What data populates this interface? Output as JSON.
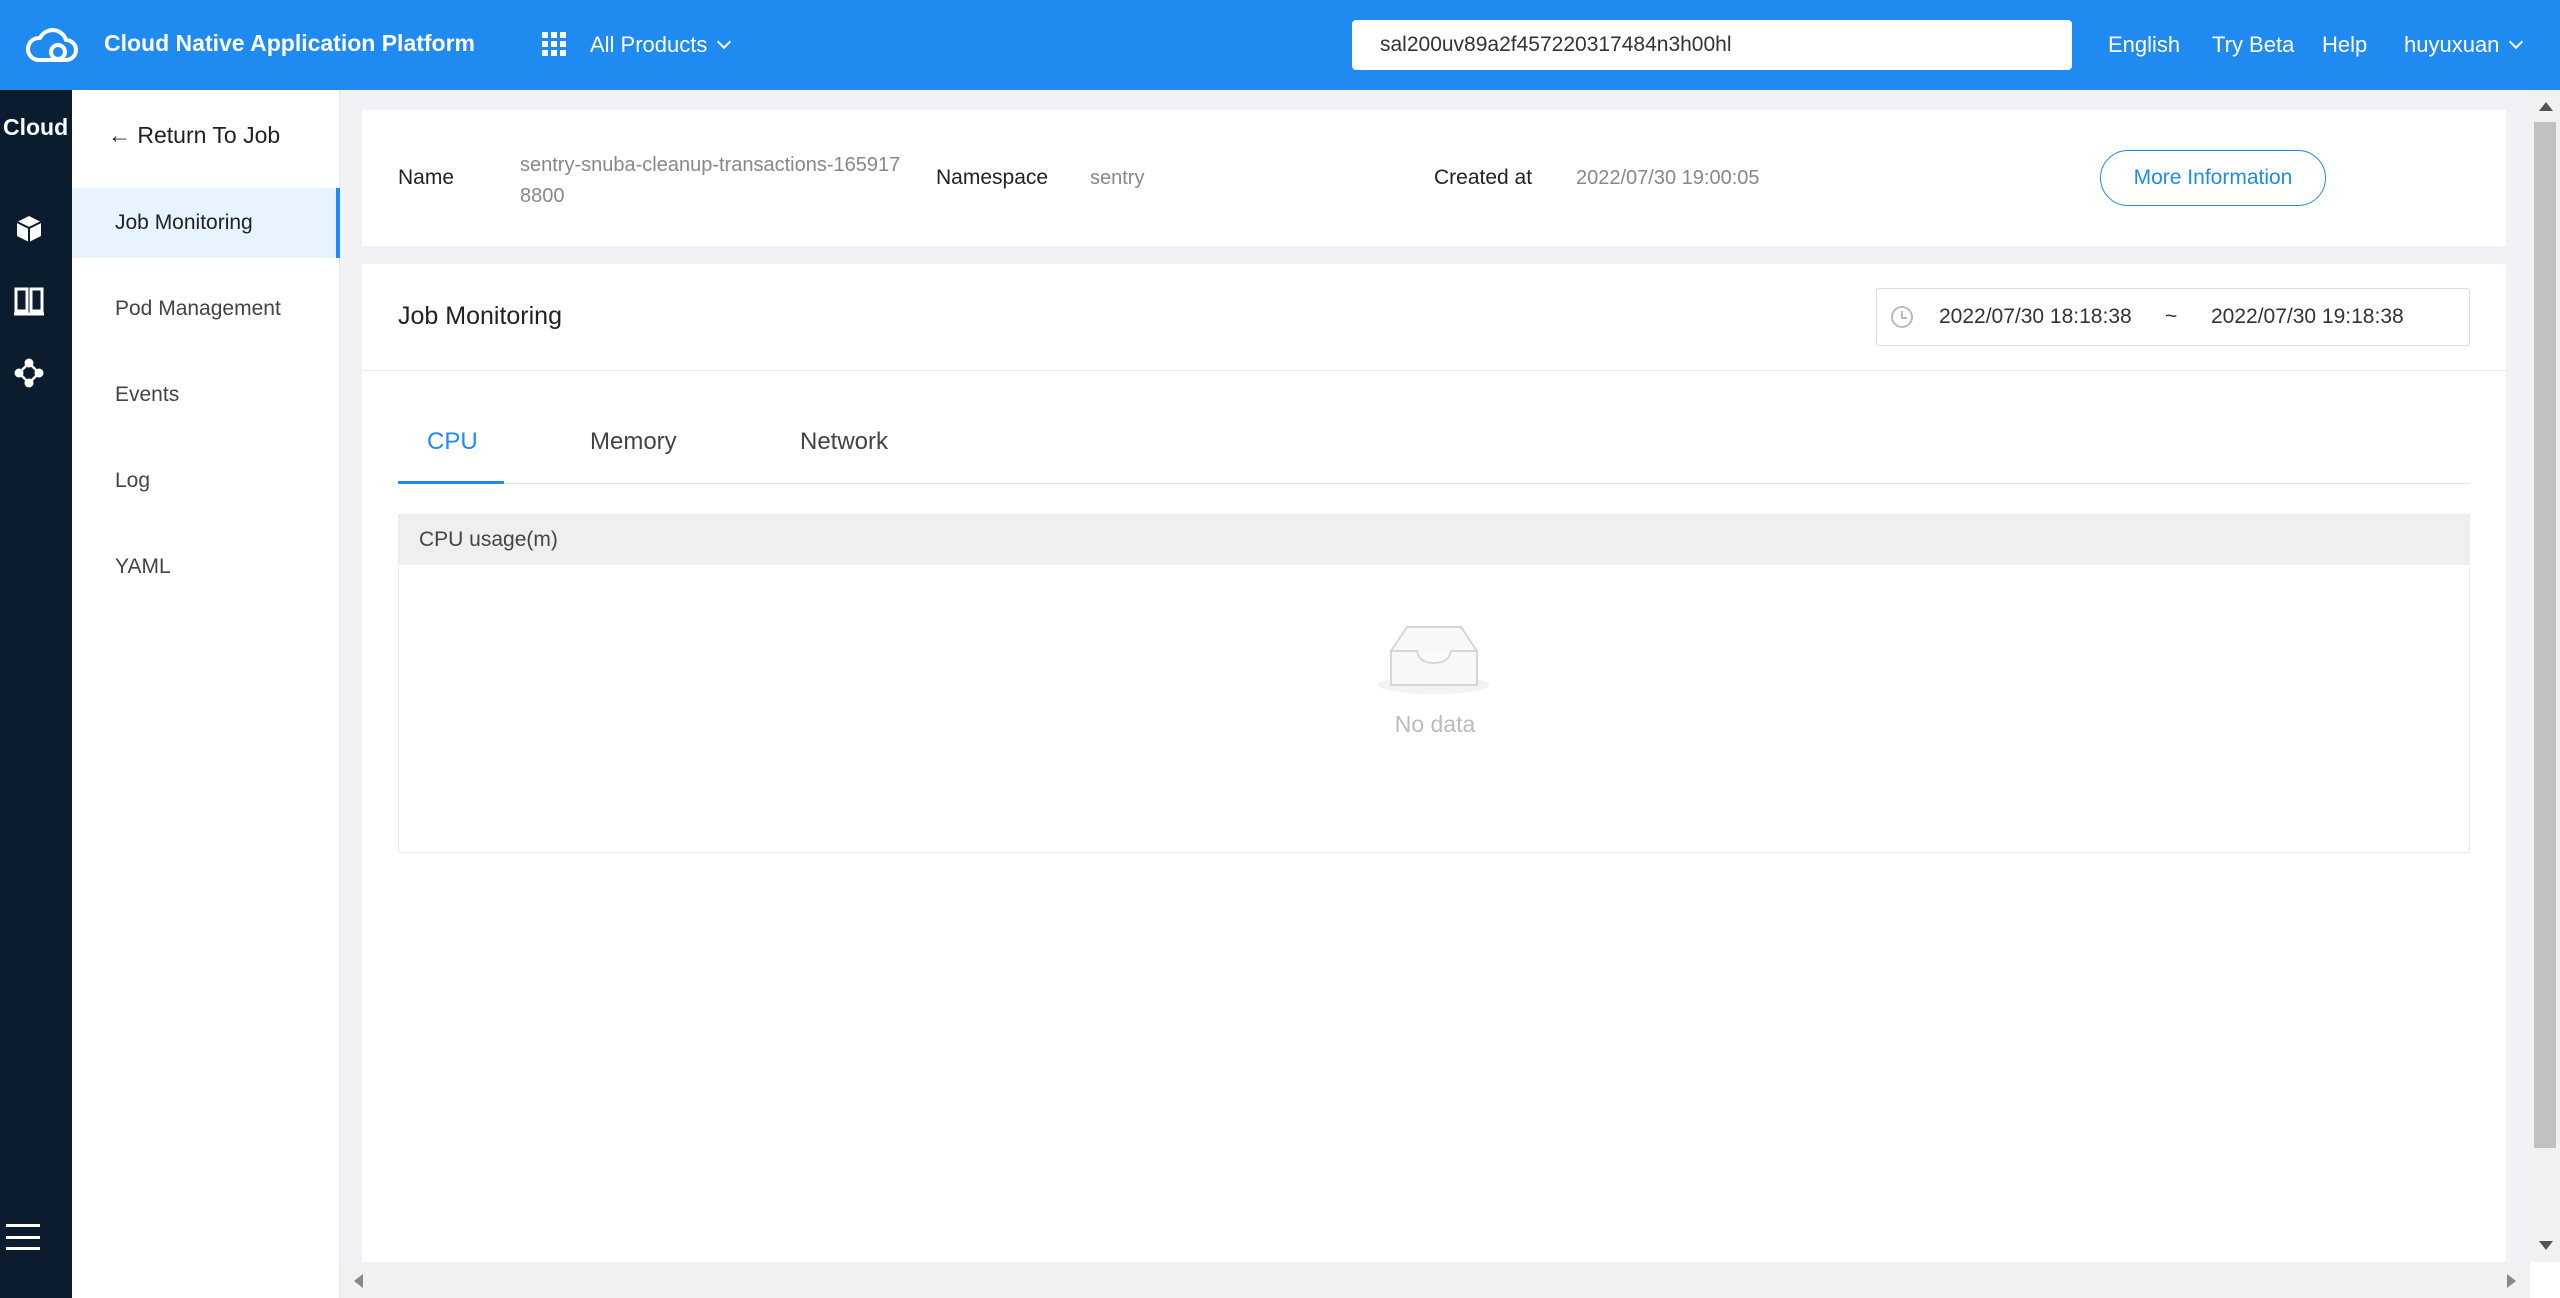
{
  "topbar": {
    "brand": "Cloud Native Application Platform",
    "all_products": "All Products",
    "search_value": "sal200uv89a2f457220317484n3h00hl",
    "language": "English",
    "try_beta": "Try Beta",
    "help": "Help",
    "user": "huyuxuan"
  },
  "rail": {
    "title": "Cloud",
    "icons": [
      "cube-icon",
      "columns-icon",
      "network-icon",
      "hamburger-menu-icon"
    ]
  },
  "sidenav": {
    "return": "Return To Job",
    "items": [
      {
        "label": "Job Monitoring",
        "active": true
      },
      {
        "label": "Pod Management"
      },
      {
        "label": "Events"
      },
      {
        "label": "Log"
      },
      {
        "label": "YAML"
      }
    ]
  },
  "info": {
    "name_label": "Name",
    "name_value_line1": "sentry-snuba-cleanup-transactions-165917",
    "name_value_line2": "8800",
    "namespace_label": "Namespace",
    "namespace_value": "sentry",
    "created_label": "Created at",
    "created_value": "2022/07/30 19:00:05",
    "more_button": "More Information"
  },
  "monitoring": {
    "title": "Job Monitoring",
    "date_start": "2022/07/30 18:18:38",
    "date_separator": "~",
    "date_end": "2022/07/30 19:18:38",
    "tabs": [
      {
        "label": "CPU",
        "active": true
      },
      {
        "label": "Memory"
      },
      {
        "label": "Network"
      }
    ],
    "chart_title": "CPU usage(m)",
    "empty_text": "No data"
  },
  "colors": {
    "primary": "#1f8bf0",
    "rail": "#0b1c2e",
    "background": "#f0f2f5"
  }
}
